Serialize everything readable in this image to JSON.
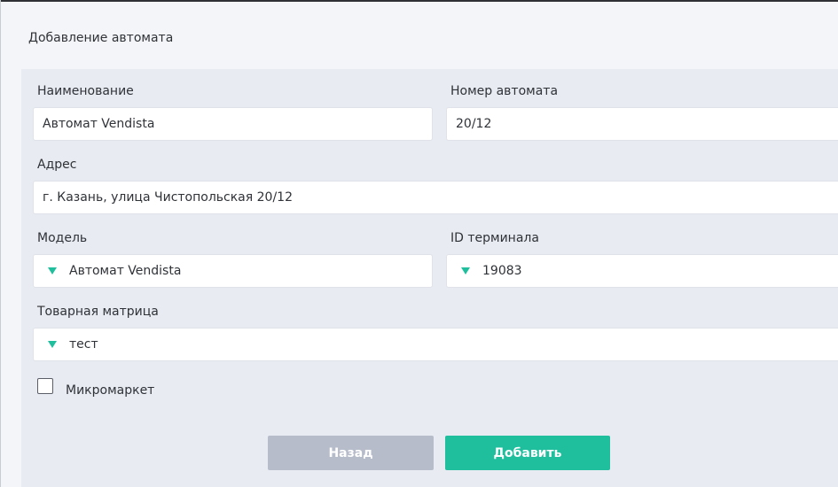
{
  "page": {
    "title": "Добавление автомата"
  },
  "form": {
    "name": {
      "label": "Наименование",
      "value": "Автомат Vendista"
    },
    "machine_number": {
      "label": "Номер автомата",
      "value": "20/12"
    },
    "address": {
      "label": "Адрес",
      "value": "г. Казань, улица Чистопольская 20/12"
    },
    "model": {
      "label": "Модель",
      "value": "Автомат Vendista"
    },
    "terminal_id": {
      "label": "ID терминала",
      "value": "19083"
    },
    "product_matrix": {
      "label": "Товарная матрица",
      "value": "тест"
    },
    "micromarket": {
      "label": "Микромаркет",
      "checked": false
    }
  },
  "actions": {
    "back_label": "Назад",
    "add_label": "Добавить"
  },
  "colors": {
    "accent": "#1fbf9e",
    "secondary_button": "#b7bcca",
    "panel_background": "#e8ebf2"
  },
  "icons": {
    "dropdown": "caret-down-icon"
  }
}
